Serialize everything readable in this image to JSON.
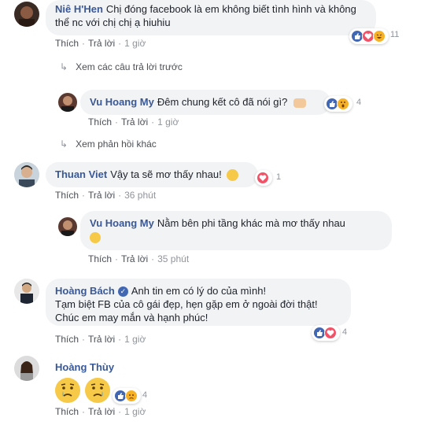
{
  "comments": [
    {
      "author": "Niê H'Hen",
      "text": "Chị đóng facebook là em không biết tình hình và không thể nc với chị chị ạ hiuhiu",
      "reply_label": "Trả lời",
      "like_label": "Thích",
      "time": "1 giờ",
      "reaction_count": "11",
      "reactions": [
        "like",
        "love",
        "haha"
      ]
    },
    {
      "author": "Vu Hoang My",
      "text": "Đêm chung kết cô đã nói gì?",
      "like_label": "Thích",
      "reply_label": "Trả lời",
      "time": "1 giờ",
      "reaction_count": "4",
      "reactions": [
        "like",
        "wow"
      ]
    },
    {
      "author": "Thuan Viet",
      "text": "Vậy ta sẽ mơ thấy nhau!",
      "like_label": "Thích",
      "reply_label": "Trả lời",
      "time": "36 phút",
      "reaction_count": "1",
      "reactions": [
        "love"
      ]
    },
    {
      "author": "Vu Hoang My",
      "text": "Nằm bên phi tầng khác mà mơ thấy nhau",
      "like_label": "Thích",
      "reply_label": "Trả lời",
      "time": "35 phút"
    },
    {
      "author": "Hoàng Bách",
      "text_lines": [
        "Anh tin em có lý do của mình!",
        "Tạm biệt FB của cô gái đẹp, hẹn gặp em ở ngoài đời thật!",
        "Chúc em may mắn và hạnh phúc!"
      ],
      "like_label": "Thích",
      "reply_label": "Trả lời",
      "time": "1 giờ",
      "reaction_count": "4",
      "reactions": [
        "like",
        "love"
      ]
    },
    {
      "author": "Hoàng Thùy",
      "like_label": "Thích",
      "reply_label": "Trả lời",
      "time": "1 giờ",
      "reaction_count": "4",
      "reactions": [
        "like",
        "sad"
      ]
    }
  ],
  "more_links": {
    "previous_replies": "Xem các câu trả lời trước",
    "other_replies": "Xem phản hồi khác"
  },
  "separator": "·",
  "colors": {
    "author": "#385898",
    "bubble": "#f2f3f5",
    "muted": "#90949c",
    "like_blue": "#4267b2",
    "love_red": "#f25268",
    "emoji_yellow": "#f7b125"
  },
  "icons": [
    "like-icon",
    "love-icon",
    "haha-icon",
    "wow-icon",
    "sad-icon",
    "verified-badge-icon",
    "reply-arrow-icon",
    "flexed-bicep-emoji",
    "kissing-emoji",
    "rofl-emoji",
    "crying-face-emoji"
  ]
}
